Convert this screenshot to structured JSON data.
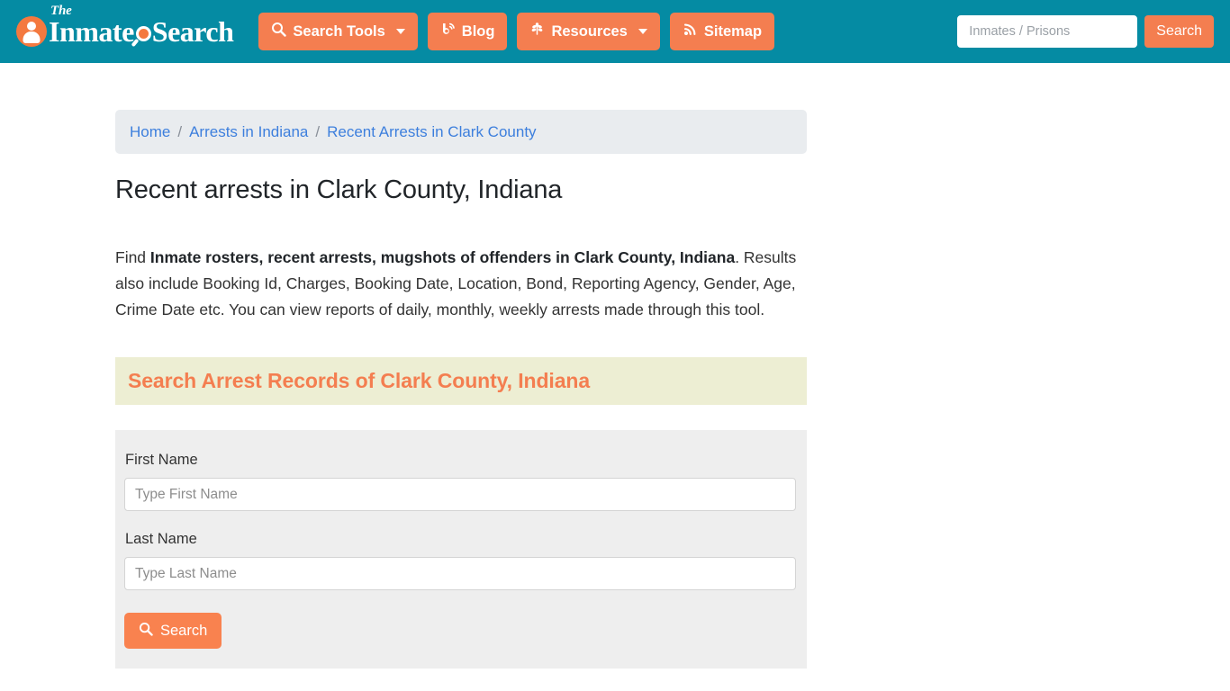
{
  "header": {
    "logo": {
      "the": "The",
      "word_one": "Inmate",
      "word_two": "Search"
    },
    "nav": [
      {
        "label": "Search Tools",
        "icon": "magnifier-icon",
        "has_caret": true
      },
      {
        "label": "Blog",
        "icon": "blog-icon",
        "has_caret": false
      },
      {
        "label": "Resources",
        "icon": "leaf-icon",
        "has_caret": true
      },
      {
        "label": "Sitemap",
        "icon": "rss-icon",
        "has_caret": false
      }
    ],
    "search": {
      "placeholder": "Inmates / Prisons",
      "value": "",
      "button_label": "Search"
    }
  },
  "breadcrumb": {
    "items": [
      "Home",
      "Arrests in Indiana",
      "Recent Arrests in Clark County"
    ],
    "separator": "/"
  },
  "main": {
    "page_title": "Recent arrests in Clark County, Indiana",
    "intro": {
      "lead": "Find ",
      "bold": "Inmate rosters, recent arrests, mugshots of offenders in Clark County, Indiana",
      "rest": ". Results also include Booking Id, Charges, Booking Date, Location, Bond, Reporting Agency, Gender, Age, Crime Date etc. You can view reports of daily, monthly, weekly arrests made through this tool."
    },
    "section_heading": "Search Arrest Records of Clark County, Indiana",
    "form": {
      "first_name": {
        "label": "First Name",
        "placeholder": "Type First Name",
        "value": ""
      },
      "last_name": {
        "label": "Last Name",
        "placeholder": "Type Last Name",
        "value": ""
      },
      "submit_label": "Search",
      "submit_icon": "magnifier-icon"
    }
  },
  "colors": {
    "header_teal": "#058ba3",
    "accent_orange": "#f47e50",
    "banner_cream": "#edeed3",
    "form_gray": "#eeeeee",
    "breadcrumb_gray": "#e9ecef",
    "link_blue": "#3d7fdd"
  }
}
